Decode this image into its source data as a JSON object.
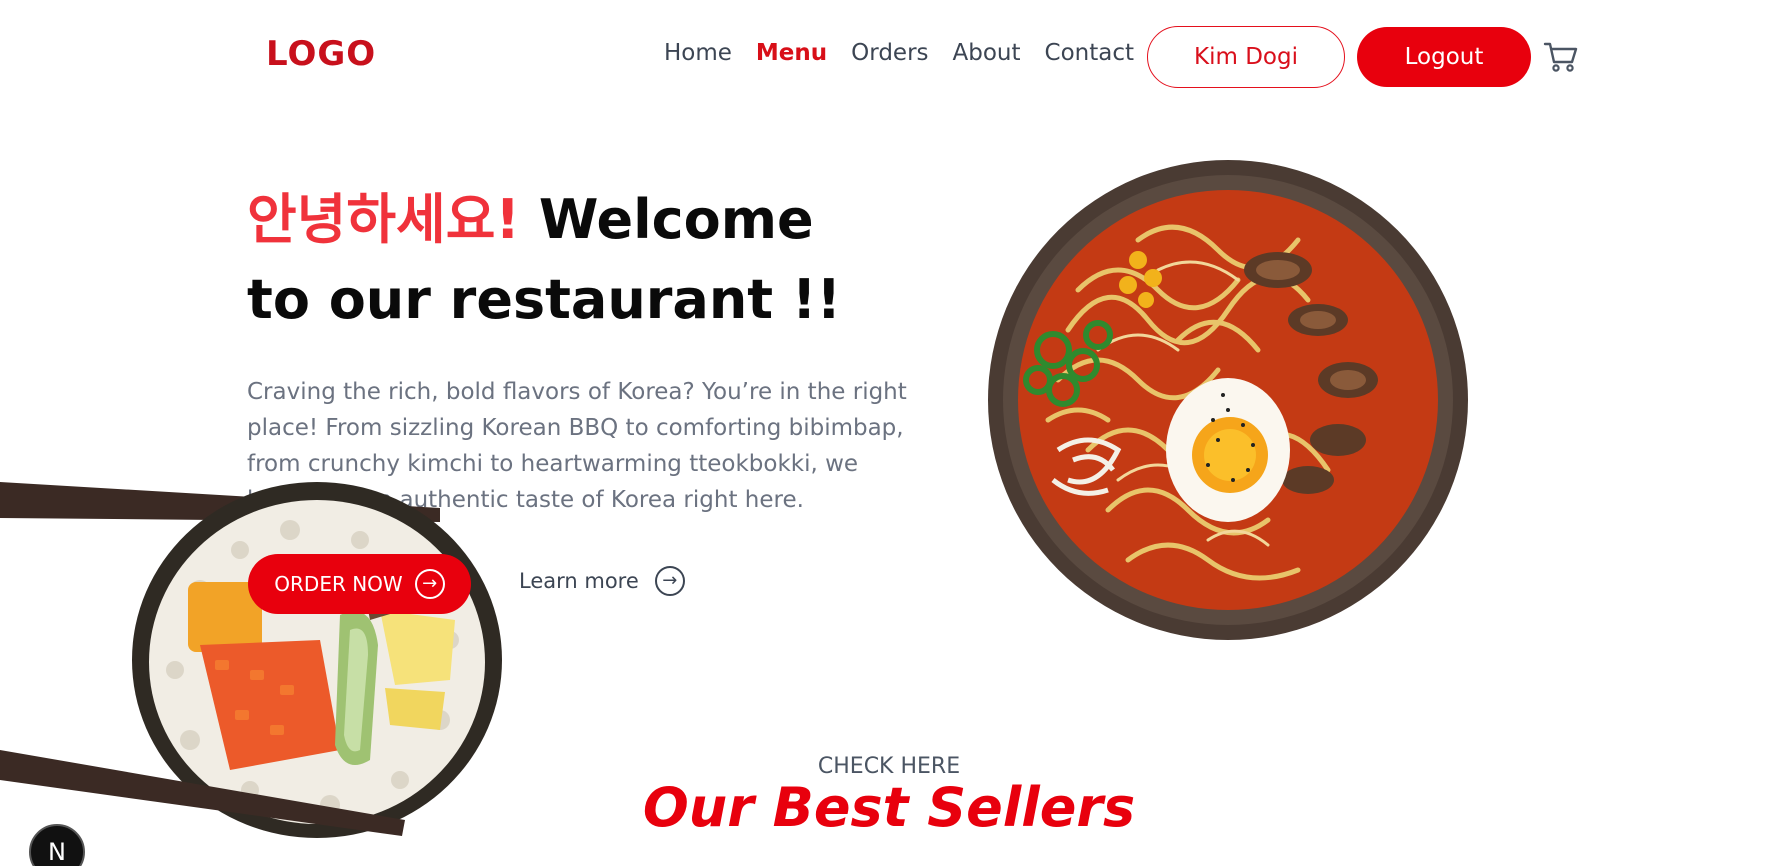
{
  "header": {
    "logo": "LOGO",
    "nav": [
      "Home",
      "Menu",
      "Orders",
      "About",
      "Contact"
    ],
    "active_nav": "Menu",
    "user_button": "Kim Dogi",
    "logout_button": "Logout",
    "cart_icon": "cart-icon"
  },
  "hero": {
    "title_korean": "안녕하세요!",
    "title_rest": "Welcome to our restaurant !!",
    "description": "Craving the rich, bold flavors of Korea? You’re in the right place! From sizzling Korean BBQ to comforting bibimbap, from crunchy kimchi to heartwarming tteokbokki, we bring you an authentic taste of Korea right here.",
    "order_button": "ORDER NOW",
    "learn_more": "Learn more"
  },
  "section": {
    "eyebrow": "CHECK HERE",
    "title": "Our Best Sellers"
  },
  "badge": {
    "letter": "N"
  },
  "colors": {
    "brand_red": "#e8000d",
    "korean_red": "#f0323b",
    "nav_text": "#3c4553",
    "body_text": "#6b7280"
  }
}
